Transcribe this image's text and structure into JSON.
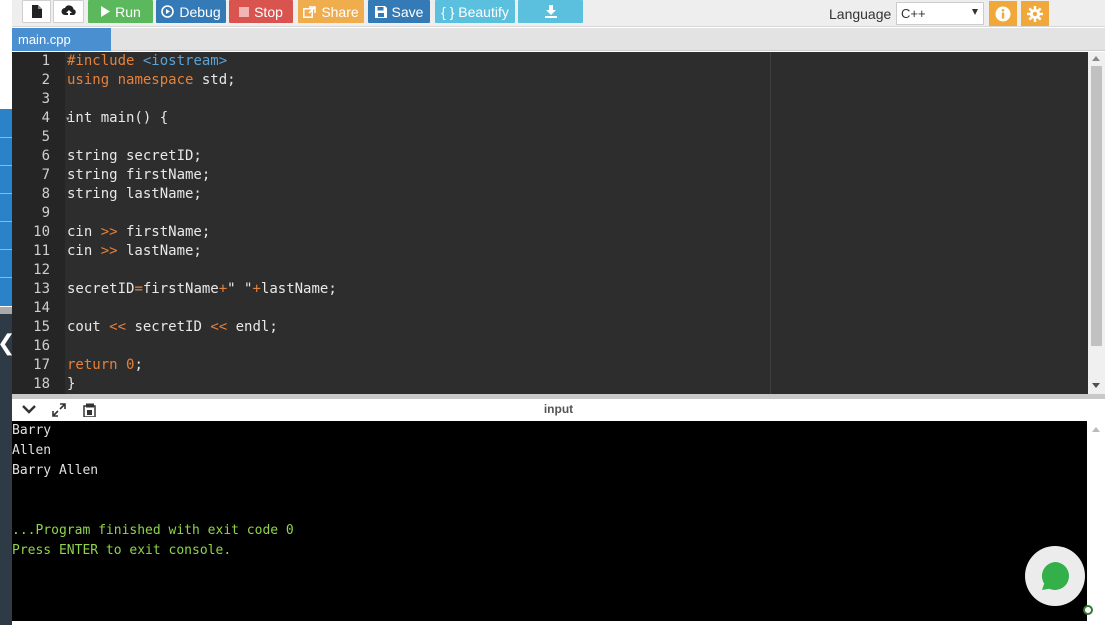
{
  "toolbar": {
    "run_label": "Run",
    "debug_label": "Debug",
    "stop_label": "Stop",
    "share_label": "Share",
    "save_label": "Save",
    "beautify_label": "{ } Beautify",
    "language_label": "Language",
    "language_value": "C++"
  },
  "tabs": [
    {
      "label": "main.cpp",
      "active": true
    }
  ],
  "editor": {
    "line_numbers": [
      "1",
      "2",
      "3",
      "4",
      "5",
      "6",
      "7",
      "8",
      "9",
      "10",
      "11",
      "12",
      "13",
      "14",
      "15",
      "16",
      "17",
      "18"
    ]
  },
  "console": {
    "title": "input",
    "lines": [
      {
        "text": "Barry",
        "color": "#e0e0e0"
      },
      {
        "text": "Allen",
        "color": "#e0e0e0"
      },
      {
        "text": "Barry Allen",
        "color": "#e0e0e0"
      },
      {
        "text": "",
        "color": "#e0e0e0"
      },
      {
        "text": "",
        "color": "#e0e0e0"
      },
      {
        "text": "...Program finished with exit code 0",
        "color": "#8fd44a"
      },
      {
        "text": "Press ENTER to exit console.",
        "color": "#8fd44a"
      }
    ]
  },
  "colors": {
    "run": "#5cb85c",
    "debug": "#337ab7",
    "stop": "#d9534f",
    "share": "#f0ad4e",
    "save": "#337ab7",
    "beautify": "#5bc0de",
    "download": "#5bc0de",
    "settings": "#f0a83a",
    "tab_active": "#4a8fcf",
    "editor_bg": "#2d2d2d",
    "console_text_success": "#8fd44a"
  },
  "icons": [
    "file-icon",
    "upload-icon",
    "play-icon",
    "debug-icon",
    "stop-icon",
    "share-icon",
    "save-icon",
    "download-icon",
    "info-icon",
    "gear-icon",
    "collapse-icon",
    "expand-icon",
    "copy-icon",
    "chat-icon"
  ]
}
